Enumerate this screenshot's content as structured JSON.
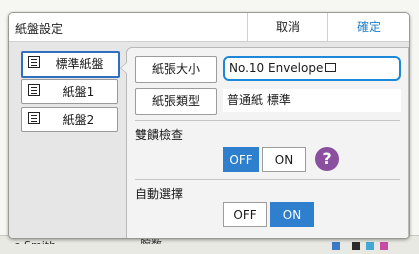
{
  "background": {
    "user_text": "o.Smith",
    "mid_text": "腕数"
  },
  "dialog": {
    "title": "紙盤設定",
    "cancel_label": "取消",
    "confirm_label": "確定"
  },
  "trays": [
    {
      "label": "標準紙盤",
      "selected": true
    },
    {
      "label": "紙盤1",
      "selected": false
    },
    {
      "label": "紙盤2",
      "selected": false
    }
  ],
  "settings": {
    "paper_size_label": "紙張大小",
    "paper_size_value": "No.10 Envelope",
    "paper_type_label": "紙張類型",
    "paper_type_value": "普通紙 標準",
    "double_feed_label": "雙饋檢查",
    "double_feed_off": "OFF",
    "double_feed_on": "ON",
    "double_feed_state": "OFF",
    "help_symbol": "?",
    "auto_select_label": "自動選擇",
    "auto_select_off": "OFF",
    "auto_select_on": "ON",
    "auto_select_state": "ON"
  },
  "colors": {
    "accent": "#2e7fce",
    "confirm_text": "#1f7fc8",
    "help_bg": "#8a4f9e",
    "selection_border": "#1e88d8"
  },
  "icons": [
    "tray-icon",
    "envelope-icon",
    "help-icon"
  ]
}
